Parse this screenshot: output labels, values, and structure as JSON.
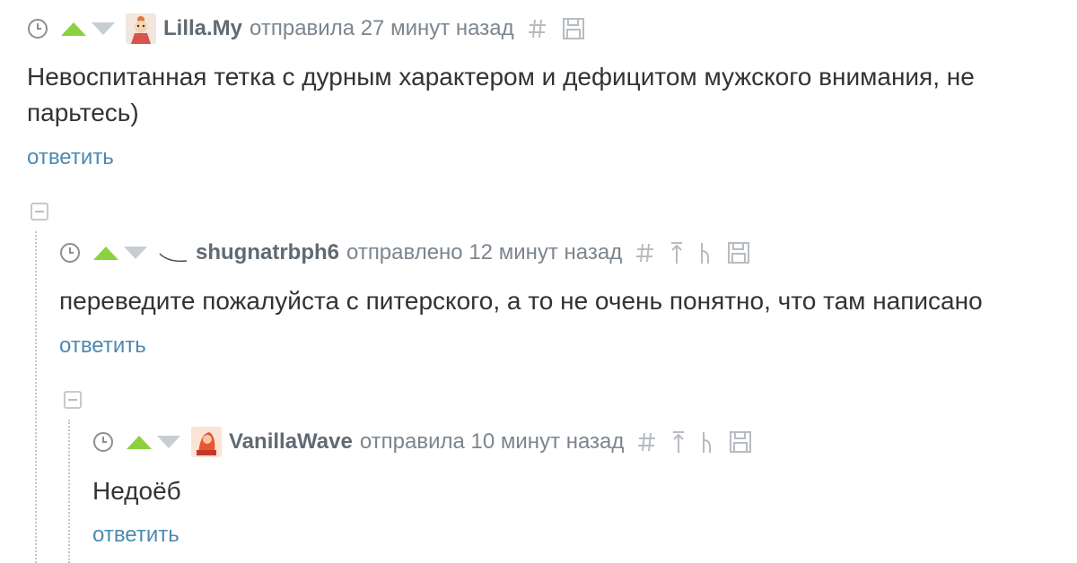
{
  "comments": [
    {
      "username": "Lilla.My",
      "meta": "отправила 27 минут назад",
      "text": "Невоспитанная тетка с дурным характером и дефицитом мужского внимания, не парьтесь)",
      "reply": "ответить",
      "avatar": "doll-avatar"
    },
    {
      "username": "shugnatrbph6",
      "meta": "отправлено 12 минут назад",
      "text": "переведите пожалуйста с питерского, а то не очень понятно, что там написано",
      "reply": "ответить",
      "avatar": "swoosh-avatar"
    },
    {
      "username": "VanillaWave",
      "meta": "отправила 10 минут назад",
      "text": "Недоёб",
      "reply": "ответить",
      "avatar": "orange-avatar"
    }
  ],
  "colors": {
    "upvote": "#8cd13f",
    "downvote": "#c8cdd2",
    "link": "#4d89b2",
    "username": "#5f6a73",
    "meta": "#7c858e"
  },
  "icons": [
    "clock-icon",
    "upvote-icon",
    "downvote-icon",
    "hash-icon",
    "parent-arrow-icon",
    "thread-icon",
    "save-icon",
    "collapse-icon"
  ]
}
